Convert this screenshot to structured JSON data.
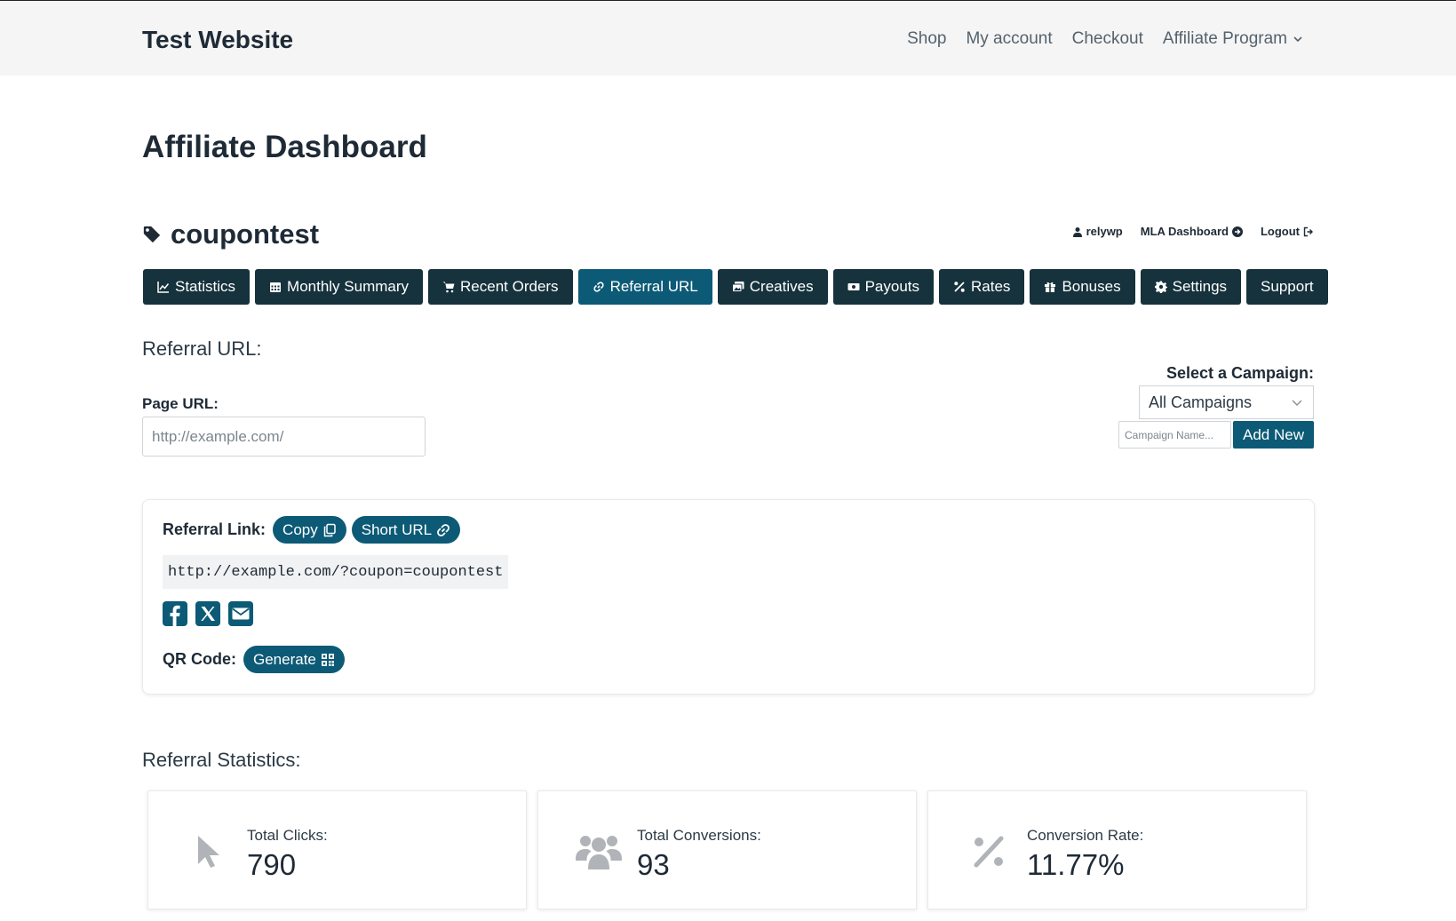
{
  "site": {
    "title": "Test Website"
  },
  "nav": [
    {
      "label": "Shop"
    },
    {
      "label": "My account"
    },
    {
      "label": "Checkout"
    },
    {
      "label": "Affiliate Program",
      "has_dropdown": true
    }
  ],
  "page": {
    "title": "Affiliate Dashboard"
  },
  "affiliate": {
    "name": "coupontest",
    "username": "relywp",
    "mla_link": "MLA Dashboard",
    "logout_link": "Logout"
  },
  "tabs": [
    {
      "label": "Statistics",
      "icon": "chart-line-icon"
    },
    {
      "label": "Monthly Summary",
      "icon": "calendar-icon"
    },
    {
      "label": "Recent Orders",
      "icon": "cart-icon"
    },
    {
      "label": "Referral URL",
      "icon": "link-icon",
      "active": true
    },
    {
      "label": "Creatives",
      "icon": "images-icon"
    },
    {
      "label": "Payouts",
      "icon": "money-icon"
    },
    {
      "label": "Rates",
      "icon": "percent-icon"
    },
    {
      "label": "Bonuses",
      "icon": "gift-icon"
    },
    {
      "label": "Settings",
      "icon": "gear-icon"
    },
    {
      "label": "Support"
    }
  ],
  "referral_url": {
    "heading": "Referral URL:",
    "page_url_label": "Page URL:",
    "page_url_placeholder": "http://example.com/",
    "campaign_label": "Select a Campaign:",
    "campaign_selected": "All Campaigns",
    "campaign_name_placeholder": "Campaign Name...",
    "add_new_label": "Add New",
    "referral_link_label": "Referral Link:",
    "copy_label": "Copy",
    "short_url_label": "Short URL",
    "link": "http://example.com/?coupon=coupontest",
    "share": [
      "facebook-icon",
      "x-twitter-icon",
      "email-icon"
    ],
    "qr_label": "QR Code:",
    "generate_label": "Generate"
  },
  "stats": {
    "heading": "Referral Statistics:",
    "cards": [
      {
        "title": "Total Clicks:",
        "value": "790",
        "icon": "pointer-icon"
      },
      {
        "title": "Total Conversions:",
        "value": "93",
        "icon": "users-icon"
      },
      {
        "title": "Conversion Rate:",
        "value": "11.77%",
        "icon": "percent-icon"
      }
    ]
  },
  "colors": {
    "primary_dark": "#16323c",
    "accent": "#0c5a76",
    "header_bg": "#f5f5f5"
  }
}
